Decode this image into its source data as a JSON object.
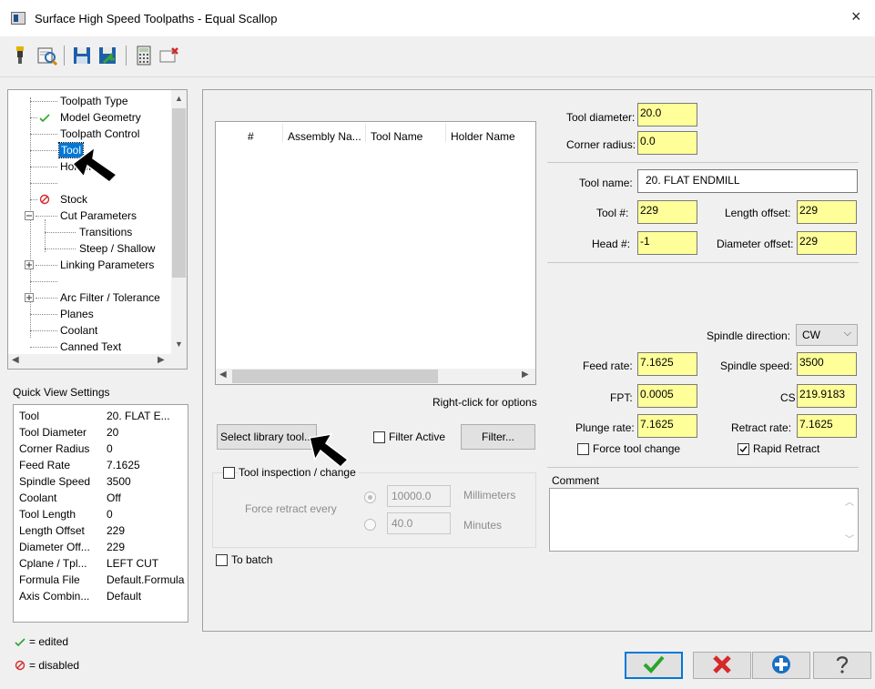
{
  "window": {
    "title": "Surface High Speed Toolpaths - Equal Scallop",
    "close": "×"
  },
  "toolbar": {
    "icons": [
      "tool-icon",
      "preview-icon",
      "save-icon",
      "export-icon",
      "calculator-icon",
      "clear-icon"
    ]
  },
  "tree": {
    "items": [
      {
        "label": "Toolpath Type"
      },
      {
        "label": "Model Geometry"
      },
      {
        "label": "Toolpath Control"
      },
      {
        "label": "Tool"
      },
      {
        "label": "Holder"
      },
      {
        "label": "Stock"
      },
      {
        "label": "Cut Parameters"
      },
      {
        "label": "Transitions"
      },
      {
        "label": "Steep / Shallow"
      },
      {
        "label": "Linking Parameters"
      },
      {
        "label": "Arc Filter / Tolerance"
      },
      {
        "label": "Planes"
      },
      {
        "label": "Coolant"
      },
      {
        "label": "Canned Text"
      }
    ]
  },
  "quick_view": {
    "title": "Quick View Settings",
    "rows": [
      {
        "k": "Tool",
        "v": "20. FLAT E..."
      },
      {
        "k": "Tool Diameter",
        "v": "20"
      },
      {
        "k": "Corner Radius",
        "v": "0"
      },
      {
        "k": "Feed Rate",
        "v": "7.1625"
      },
      {
        "k": "Spindle Speed",
        "v": "3500"
      },
      {
        "k": "Coolant",
        "v": "Off"
      },
      {
        "k": "Tool Length",
        "v": "0"
      },
      {
        "k": "Length Offset",
        "v": "229"
      },
      {
        "k": "Diameter Off...",
        "v": "229"
      },
      {
        "k": "Cplane / Tpl...",
        "v": "LEFT CUT"
      },
      {
        "k": "Formula File",
        "v": "Default.Formula"
      },
      {
        "k": "Axis Combin...",
        "v": "Default"
      }
    ]
  },
  "legend": {
    "edited": "= edited",
    "disabled": "= disabled"
  },
  "tool_list": {
    "columns": [
      "#",
      "Assembly Na...",
      "Tool Name",
      "Holder Name"
    ],
    "hint": "Right-click for options"
  },
  "buttons": {
    "select_library": "Select library tool...",
    "filter_active": "Filter Active",
    "filter": "Filter...",
    "tool_inspection": "Tool inspection / change",
    "force_retract": "Force retract every",
    "retract_mm_value": "10000.0",
    "retract_mm_unit": "Millimeters",
    "retract_min_value": "40.0",
    "retract_min_unit": "Minutes",
    "to_batch": "To batch"
  },
  "tool_params": {
    "tool_diameter_label": "Tool diameter:",
    "tool_diameter": "20.0",
    "corner_radius_label": "Corner radius:",
    "corner_radius": "0.0",
    "tool_name_label": "Tool name:",
    "tool_name": "20. FLAT ENDMILL",
    "tool_num_label": "Tool #:",
    "tool_num": "229",
    "length_offset_label": "Length offset:",
    "length_offset": "229",
    "head_num_label": "Head #:",
    "head_num": "-1",
    "diameter_offset_label": "Diameter offset:",
    "diameter_offset": "229",
    "spindle_dir_label": "Spindle direction:",
    "spindle_dir": "CW",
    "feed_rate_label": "Feed rate:",
    "feed_rate": "7.1625",
    "spindle_speed_label": "Spindle speed:",
    "spindle_speed": "3500",
    "fpt_label": "FPT:",
    "fpt": "0.0005",
    "cs_label": "CS",
    "cs": "219.9183",
    "plunge_rate_label": "Plunge rate:",
    "plunge_rate": "7.1625",
    "retract_rate_label": "Retract rate:",
    "retract_rate": "7.1625",
    "force_tool_change": "Force tool change",
    "rapid_retract": "Rapid Retract",
    "comment_label": "Comment"
  },
  "colors": {
    "field_yellow": "#ffff99",
    "edited_green": "#2aa52a",
    "disabled_red": "#d42a2a"
  }
}
